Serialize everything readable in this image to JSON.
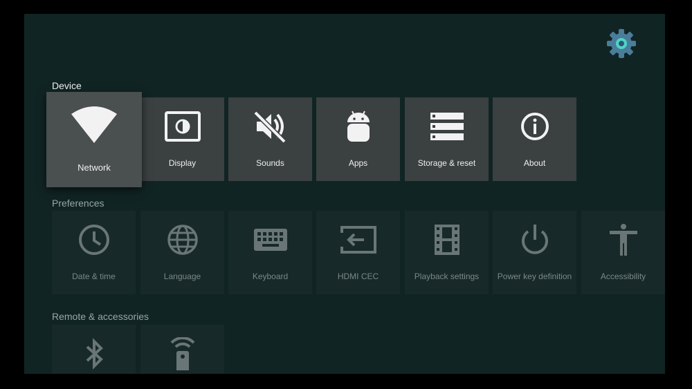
{
  "settings_icon": "gear-icon",
  "sections": {
    "device": "Device",
    "preferences": "Preferences",
    "remote": "Remote & accessories"
  },
  "device_items": [
    {
      "label": "Network",
      "icon": "wifi-icon"
    },
    {
      "label": "Display",
      "icon": "display-icon"
    },
    {
      "label": "Sounds",
      "icon": "sound-muted-icon"
    },
    {
      "label": "Apps",
      "icon": "android-icon"
    },
    {
      "label": "Storage & reset",
      "icon": "storage-icon"
    },
    {
      "label": "About",
      "icon": "info-icon"
    }
  ],
  "preference_items": [
    {
      "label": "Date & time",
      "icon": "clock-icon"
    },
    {
      "label": "Language",
      "icon": "globe-icon"
    },
    {
      "label": "Keyboard",
      "icon": "keyboard-icon"
    },
    {
      "label": "HDMI CEC",
      "icon": "hdmi-input-icon"
    },
    {
      "label": "Playback settings",
      "icon": "film-icon"
    },
    {
      "label": "Power key definition",
      "icon": "power-icon"
    },
    {
      "label": "Accessibility",
      "icon": "accessibility-icon"
    }
  ],
  "remote_items": [
    {
      "icon": "bluetooth-icon"
    },
    {
      "icon": "remote-control-icon"
    }
  ],
  "colors": {
    "background": "#112424",
    "tile": "#3b4040",
    "tile_focused": "#4a4f4f",
    "tile_dim": "#172929",
    "accent": "#4fd3c9"
  }
}
